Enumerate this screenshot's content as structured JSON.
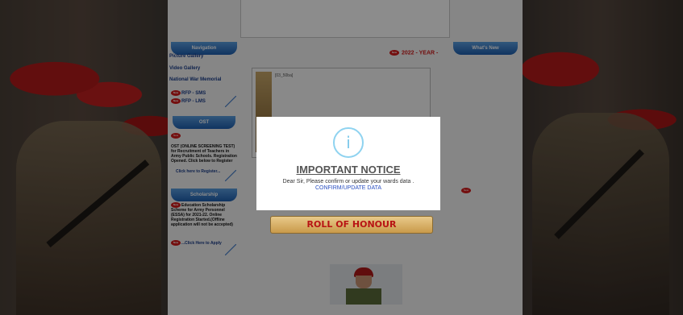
{
  "left_nav": {
    "header": "Navigation",
    "links": [
      "Picture Gallery",
      "Video Gallery",
      "National War Memorial"
    ],
    "new_badge": "New",
    "rfp_sms": "RFP - SMS",
    "rfp_lms": "RFP - LMS"
  },
  "ost": {
    "header": "OST",
    "text": "OST (ONLINE SCREENING TEST) for Recruitment of Teachers in Army Public Schools. Registration Opened. Click below to Register",
    "register_link": "Click here to Register..."
  },
  "scholarship": {
    "header": "Scholarship",
    "text": "Education Scholarship Scheme for Army Personnel (ESSA) for 2021-22. Online Registration Started.(Offline application will not be accepted)",
    "apply_link": "...Click Here to Apply"
  },
  "right_nav": {
    "header": "What's New"
  },
  "main": {
    "year_marquee": "2022 - YEAR -",
    "image_alt": "[03_50ba]",
    "roll_of_honour": "ROLL OF HONOUR"
  },
  "modal": {
    "icon": "i",
    "title": "IMPORTANT NOTICE",
    "message": "Dear Sir, Please confirm or update your wards data .",
    "link": "CONFIRM/UPDATE DATA"
  }
}
